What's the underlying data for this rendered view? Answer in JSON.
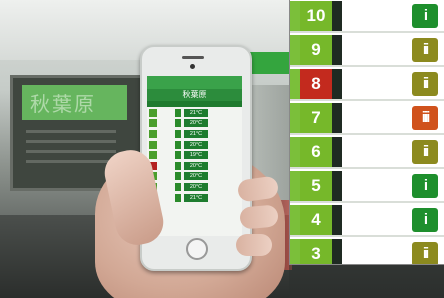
{
  "phone": {
    "station_name": "秋葉原",
    "temperatures": [
      "21°C",
      "20°C",
      "21°C",
      "20°C",
      "19°C",
      "20°C",
      "20°C",
      "20°C",
      "21°C"
    ]
  },
  "zoom": {
    "rows": [
      {
        "car": "10",
        "highlight": false,
        "crowd": "low"
      },
      {
        "car": "9",
        "highlight": false,
        "crowd": "medium"
      },
      {
        "car": "8",
        "highlight": true,
        "crowd": "medium"
      },
      {
        "car": "7",
        "highlight": false,
        "crowd": "high"
      },
      {
        "car": "6",
        "highlight": false,
        "crowd": "medium"
      },
      {
        "car": "5",
        "highlight": false,
        "crowd": "low"
      },
      {
        "car": "4",
        "highlight": false,
        "crowd": "low"
      },
      {
        "car": "3",
        "highlight": false,
        "crowd": "medium"
      }
    ]
  },
  "colors": {
    "car_green": "#76b82a",
    "car_red": "#c32a1e",
    "crowd_low": "#1e8f2d",
    "crowd_medium": "#8c8a1f",
    "crowd_high": "#d0521c"
  }
}
